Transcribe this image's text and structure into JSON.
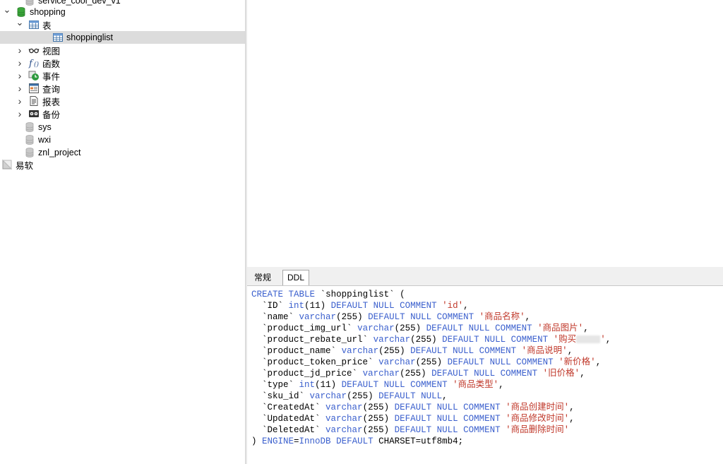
{
  "tree": {
    "items": [
      {
        "label": "service_cool_dev_v1",
        "icon": "database-icon",
        "expand": "none",
        "indent": 0
      },
      {
        "label": "shopping",
        "icon": "database-icon",
        "expand": "open",
        "indent": 0
      },
      {
        "label": "表",
        "icon": "table-icon",
        "expand": "open",
        "indent": 1
      },
      {
        "label": "shoppinglist",
        "icon": "table-icon",
        "expand": "none",
        "indent": 2
      },
      {
        "label": "视图",
        "icon": "glasses-icon",
        "expand": "closed",
        "indent": 1
      },
      {
        "label": "函数",
        "icon": "function-icon",
        "expand": "closed",
        "indent": 1
      },
      {
        "label": "事件",
        "icon": "clock-icon",
        "expand": "closed",
        "indent": 1
      },
      {
        "label": "查询",
        "icon": "query-icon",
        "expand": "closed",
        "indent": 1
      },
      {
        "label": "报表",
        "icon": "report-icon",
        "expand": "closed",
        "indent": 1
      },
      {
        "label": "备份",
        "icon": "backup-icon",
        "expand": "closed",
        "indent": 1
      },
      {
        "label": "sys",
        "icon": "database-icon",
        "expand": "none",
        "indent": 0
      },
      {
        "label": "wxi",
        "icon": "database-icon",
        "expand": "none",
        "indent": 0
      },
      {
        "label": "znl_project",
        "icon": "database-icon",
        "expand": "none",
        "indent": 0
      },
      {
        "label": "易软",
        "icon": "connection-icon",
        "expand": "none",
        "indent": -1
      }
    ]
  },
  "tabs": {
    "general": "常规",
    "ddl": "DDL"
  },
  "ddl": {
    "create": "CREATE",
    "table_kw": "TABLE",
    "table_name": "`shoppinglist`",
    "open": " (",
    "columns": [
      {
        "name": "`ID`",
        "type": "int",
        "size": "(11)",
        "comment": "'id'"
      },
      {
        "name": "`name`",
        "type": "varchar",
        "size": "(255)",
        "comment": "'商品名称'"
      },
      {
        "name": "`product_img_url`",
        "type": "varchar",
        "size": "(255)",
        "comment": "'商品图片'"
      },
      {
        "name": "`product_rebate_url`",
        "type": "varchar",
        "size": "(255)",
        "comment": "'购买"
      },
      {
        "name": "`product_name`",
        "type": "varchar",
        "size": "(255)",
        "comment": "'商品说明'"
      },
      {
        "name": "`product_token_price`",
        "type": "varchar",
        "size": "(255)",
        "comment": "'新价格'"
      },
      {
        "name": "`product_jd_price`",
        "type": "varchar",
        "size": "(255)",
        "comment": "'旧价格'"
      },
      {
        "name": "`type`",
        "type": "int",
        "size": "(11)",
        "comment": "'商品类型'"
      },
      {
        "name": "`sku_id`",
        "type": "varchar",
        "size": "(255)",
        "comment": ""
      },
      {
        "name": "`CreatedAt`",
        "type": "varchar",
        "size": "(255)",
        "comment": "'商品创建时间'"
      },
      {
        "name": "`UpdatedAt`",
        "type": "varchar",
        "size": "(255)",
        "comment": "'商品修改时间'"
      },
      {
        "name": "`DeletedAt`",
        "type": "varchar",
        "size": "(255)",
        "comment": "'商品删除时间'"
      }
    ],
    "default_null": "DEFAULT NULL",
    "comment_kw": "COMMENT",
    "footer_close": ") ",
    "footer_engine": "ENGINE",
    "footer_eq1": "=",
    "footer_innodb": "InnoDB",
    "footer_default": "DEFAULT",
    "footer_charset": "CHARSET=utf8mb4;",
    "redacted_tail": "'"
  },
  "colors": {
    "keyword": "#3a5fcd",
    "string": "#c0392b",
    "selected_row": "#dcdcdc",
    "db_green": "#3aa63a"
  }
}
